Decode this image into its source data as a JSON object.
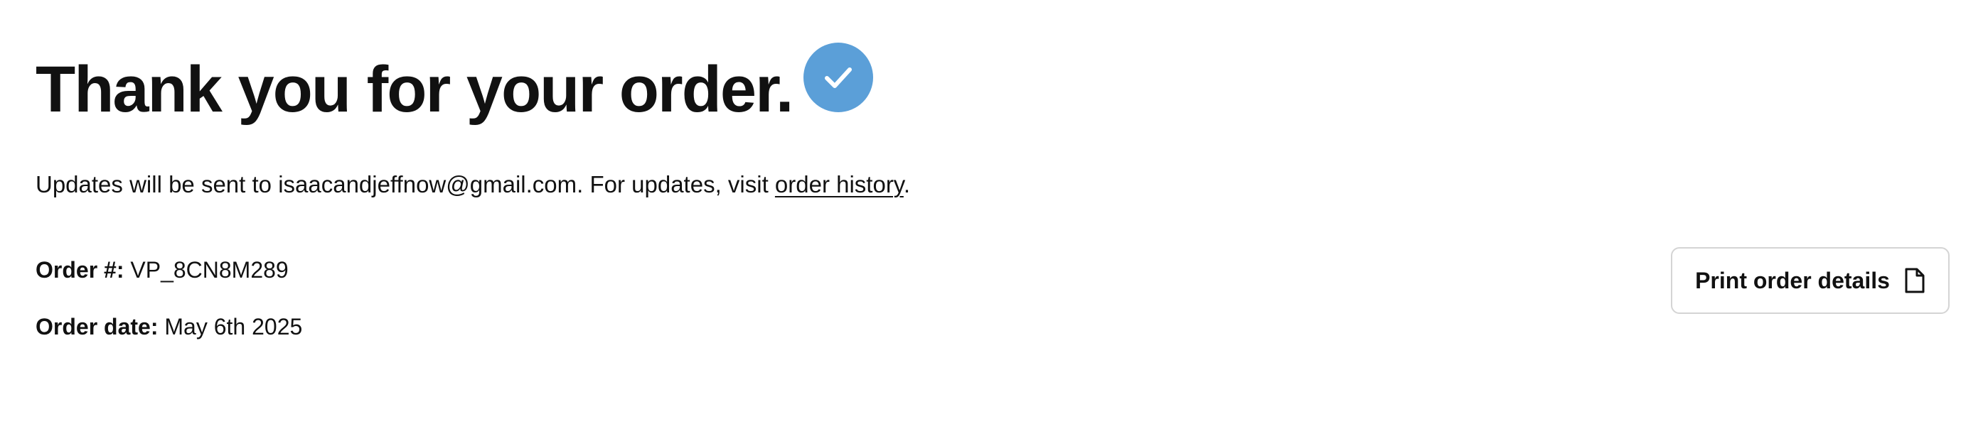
{
  "header": {
    "title": "Thank you for your order.",
    "check_icon": "check-circle-icon",
    "accent_color": "#5b9fd8"
  },
  "updates": {
    "prefix": "Updates will be sent to ",
    "email": "isaacandjeffnow@gmail.com",
    "middle": ". For updates, visit ",
    "link_label": "order history",
    "suffix": "."
  },
  "order": {
    "number_label": "Order #:",
    "number_value": "VP_8CN8M289",
    "date_label": "Order date:",
    "date_value": "May 6th 2025"
  },
  "actions": {
    "print_label": "Print order details",
    "print_icon": "document-icon"
  }
}
